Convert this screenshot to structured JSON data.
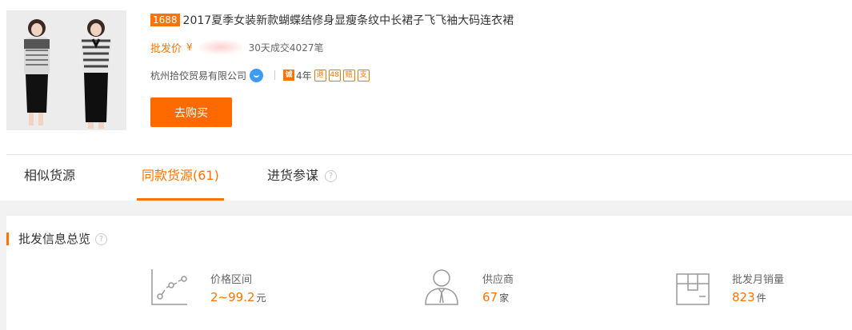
{
  "product": {
    "badge": "1688",
    "title": "2017夏季女装新款蝴蝶结修身显瘦条纹中长裙子飞飞袖大码连衣裙",
    "price_label": "批发价",
    "currency": "¥",
    "sales": "30天成交4027笔",
    "company": "杭州拾佼贸易有限公司",
    "trustpass_icon": "诚",
    "years": "4年",
    "service_icons": [
      "退",
      "48",
      "赔",
      "支"
    ],
    "buy_button": "去购买"
  },
  "tabs": [
    {
      "label": "相似货源"
    },
    {
      "label": "同款货源(61)"
    },
    {
      "label": "进货参谋"
    }
  ],
  "help_icon": "?",
  "overview": {
    "title": "批发信息总览",
    "stats": [
      {
        "label": "价格区间",
        "value": "2~99.2",
        "unit": "元",
        "icon": "price-trend-icon"
      },
      {
        "label": "供应商",
        "value": "67",
        "unit": "家",
        "icon": "supplier-icon"
      },
      {
        "label": "批发月销量",
        "value": "823",
        "unit": "件",
        "icon": "box-icon"
      }
    ]
  },
  "colors": {
    "accent": "#ff7300",
    "button": "#ff6a00",
    "info_blue": "#3d9bf0"
  }
}
